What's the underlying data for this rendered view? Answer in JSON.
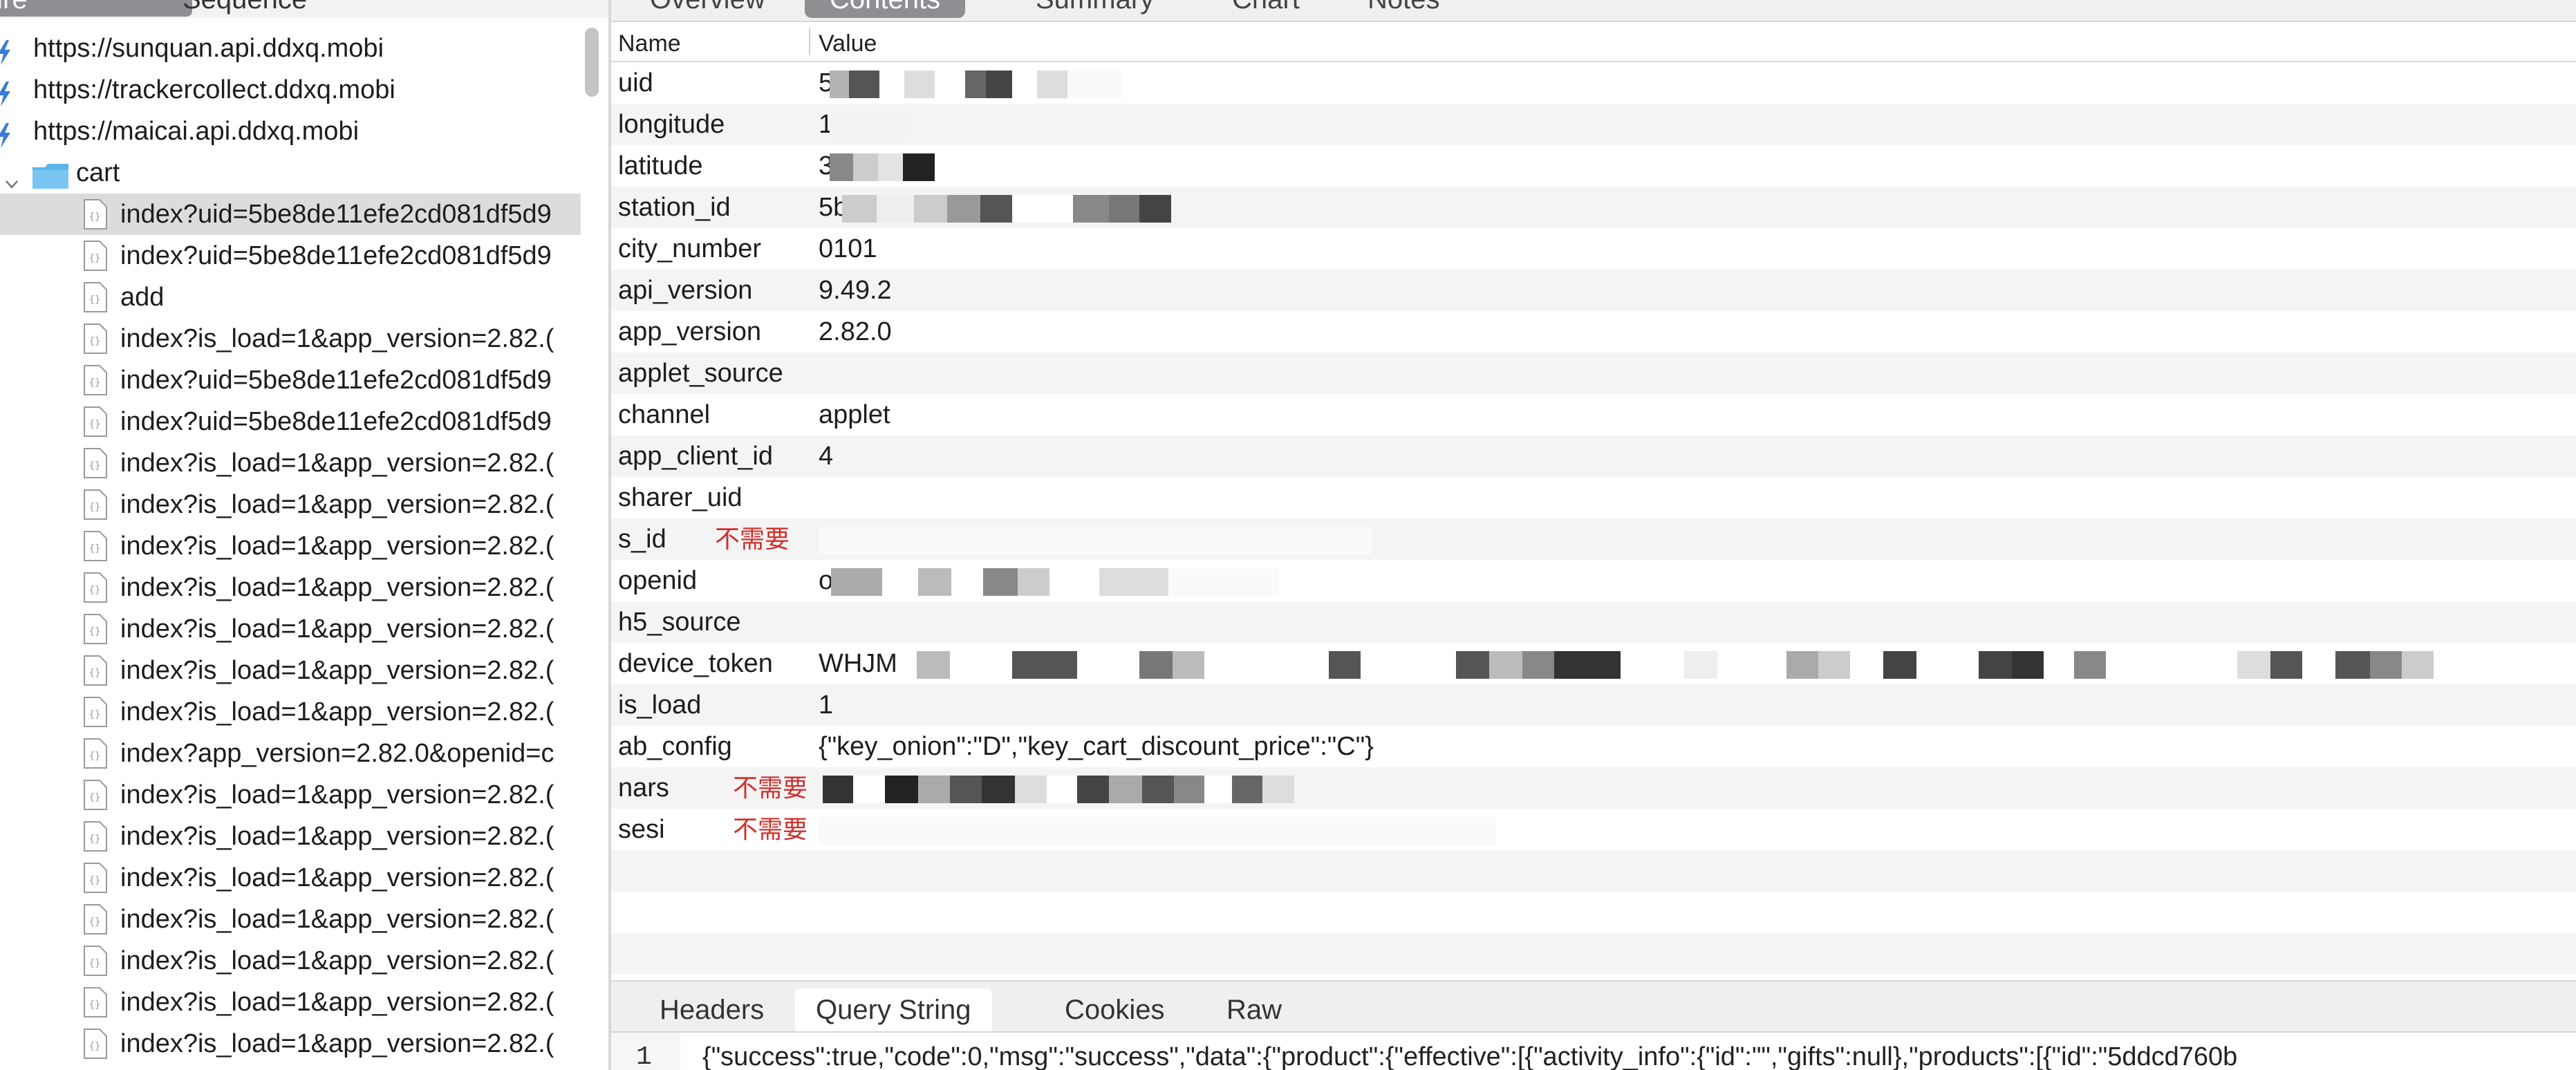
{
  "left_tabs": {
    "structure": "tructure",
    "sequence": "Sequence"
  },
  "hosts": [
    "https://sunquan.api.ddxq.mobi",
    "https://trackercollect.ddxq.mobi",
    "https://maicai.api.ddxq.mobi"
  ],
  "folder": "cart",
  "requests": [
    "index?uid=5be8de11efe2cd081df5d9",
    "index?uid=5be8de11efe2cd081df5d9",
    "add",
    "index?is_load=1&app_version=2.82.(",
    "index?uid=5be8de11efe2cd081df5d9",
    "index?uid=5be8de11efe2cd081df5d9",
    "index?is_load=1&app_version=2.82.(",
    "index?is_load=1&app_version=2.82.(",
    "index?is_load=1&app_version=2.82.(",
    "index?is_load=1&app_version=2.82.(",
    "index?is_load=1&app_version=2.82.(",
    "index?is_load=1&app_version=2.82.(",
    "index?is_load=1&app_version=2.82.(",
    "index?app_version=2.82.0&openid=c",
    "index?is_load=1&app_version=2.82.(",
    "index?is_load=1&app_version=2.82.(",
    "index?is_load=1&app_version=2.82.(",
    "index?is_load=1&app_version=2.82.(",
    "index?is_load=1&app_version=2.82.(",
    "index?is_load=1&app_version=2.82.(",
    "index?is_load=1&app_version=2.82.("
  ],
  "top_tabs": [
    "Overview",
    "Contents",
    "Summary",
    "Chart",
    "Notes"
  ],
  "columns": {
    "name": "Name",
    "value": "Value"
  },
  "params": [
    {
      "name": "uid",
      "value": "5"
    },
    {
      "name": "longitude",
      "value": "1"
    },
    {
      "name": "latitude",
      "value": "3"
    },
    {
      "name": "station_id",
      "value": "5b"
    },
    {
      "name": "city_number",
      "value": "0101"
    },
    {
      "name": "api_version",
      "value": "9.49.2"
    },
    {
      "name": "app_version",
      "value": "2.82.0"
    },
    {
      "name": "applet_source",
      "value": ""
    },
    {
      "name": "channel",
      "value": "applet"
    },
    {
      "name": "app_client_id",
      "value": "4"
    },
    {
      "name": "sharer_uid",
      "value": ""
    },
    {
      "name": "s_id",
      "note": "不需要",
      "value": ""
    },
    {
      "name": "openid",
      "value": "o"
    },
    {
      "name": "h5_source",
      "value": ""
    },
    {
      "name": "device_token",
      "value": "WHJM"
    },
    {
      "name": "is_load",
      "value": "1"
    },
    {
      "name": "ab_config",
      "value": "{\"key_onion\":\"D\",\"key_cart_discount_price\":\"C\"}"
    },
    {
      "name": "nars",
      "note": "不需要",
      "value": ""
    },
    {
      "name": "sesi",
      "note": "不需要",
      "value": ""
    }
  ],
  "bottom_tabs": [
    "Headers",
    "Query String",
    "Cookies",
    "Raw"
  ],
  "raw": {
    "line_number": "1",
    "text": "{\"success\":true,\"code\":0,\"msg\":\"success\",\"data\":{\"product\":{\"effective\":[{\"activity_info\":{\"id\":\"\",\"gifts\":null},\"products\":[{\"id\":\"5ddcd760b"
  },
  "colors": {
    "active_tab": "#8e8e93",
    "note_red": "#d0312d",
    "selected_row": "#dcdcdc",
    "alt_row": "#f4f4f4",
    "host_icon": "#3a7bd5",
    "folder_icon": "#5ab4ea"
  }
}
